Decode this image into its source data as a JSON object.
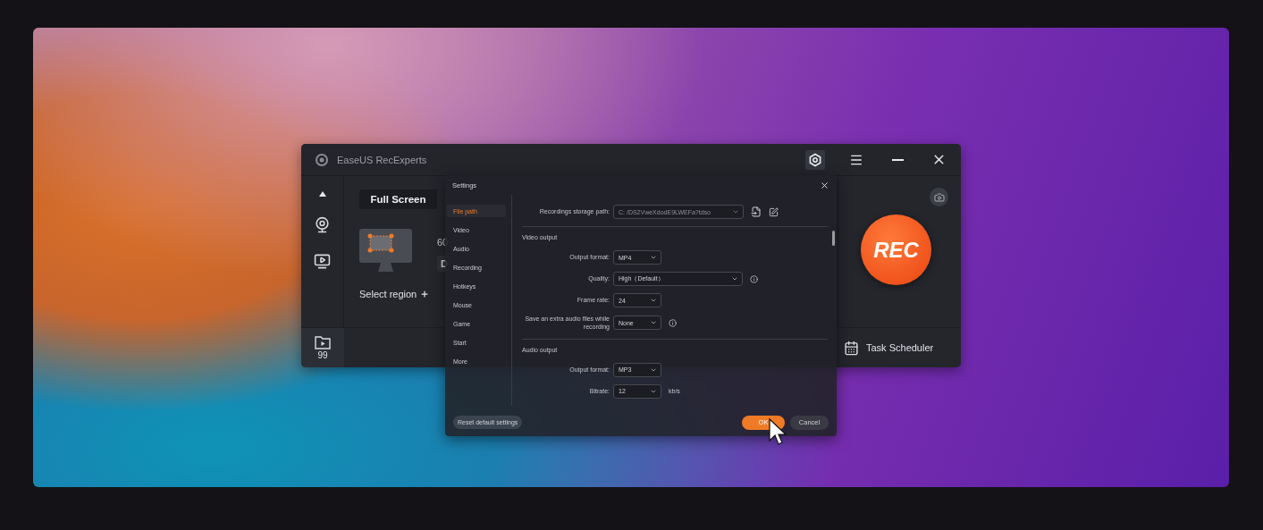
{
  "app": {
    "title": "EaseUS RecExperts",
    "tabs": [
      {
        "label": "Full Screen",
        "selected": true
      }
    ],
    "resolution": "60",
    "display": "D",
    "select_region": "Select region",
    "recordings_count": "99",
    "rec_button": "REC",
    "task_scheduler": "Task Scheduler"
  },
  "settings": {
    "title": "Settings",
    "nav": [
      {
        "label": "File path",
        "selected": true
      },
      {
        "label": "Video",
        "selected": false
      },
      {
        "label": "Audio",
        "selected": false
      },
      {
        "label": "Recording",
        "selected": false
      },
      {
        "label": "Hotkeys",
        "selected": false
      },
      {
        "label": "Mouse",
        "selected": false
      },
      {
        "label": "Game",
        "selected": false
      },
      {
        "label": "Start",
        "selected": false
      },
      {
        "label": "More",
        "selected": false
      }
    ],
    "storage_path": {
      "label": "Recordings storage path:",
      "value": "C:  /DS2VweXdodE9LWEFa?tdso"
    },
    "sections": [
      {
        "title": "Video output",
        "fields": [
          {
            "kind": "select",
            "label": "Output format:",
            "value": "MP4",
            "info": false
          },
          {
            "kind": "wide-select",
            "label": "Quality:",
            "value": "High（Default）",
            "info": true
          },
          {
            "kind": "select",
            "label": "Frame rate:",
            "value": "24",
            "info": false
          },
          {
            "kind": "select",
            "label": "Save an extra audio files while recording",
            "value": "None",
            "info": true
          }
        ]
      },
      {
        "title": "Audio output",
        "fields": [
          {
            "kind": "select",
            "label": "Output format:",
            "value": "MP3",
            "info": false
          },
          {
            "kind": "select",
            "label": "Bitrate:",
            "value": "12",
            "info": false,
            "unit": "kb/s"
          }
        ]
      }
    ],
    "reset_button": "Reset default settings",
    "ok_button": "OK",
    "cancel_button": "Cancel"
  }
}
